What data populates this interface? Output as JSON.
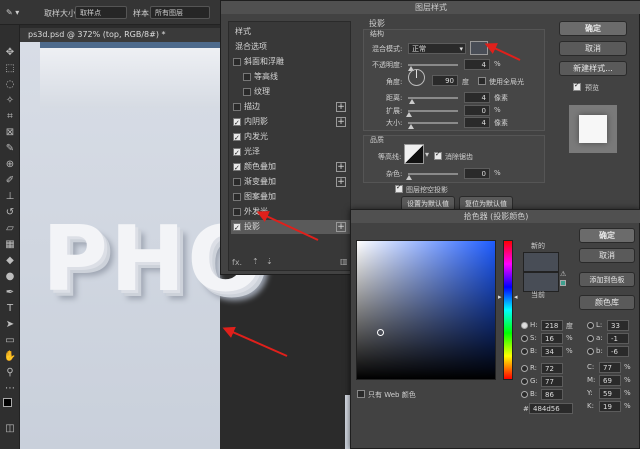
{
  "options_bar": {
    "sample_size_label": "取样大小:",
    "sample_size_value": "取样点",
    "sample_label": "样本:",
    "sample_value": "所有图层"
  },
  "document_tab": {
    "label": "ps3d.psd @ 372% (top, RGB/8#) *"
  },
  "canvas": {
    "text": "PHO"
  },
  "layer_style": {
    "title": "图层样式",
    "list": [
      {
        "label": "样式",
        "checkbox": null,
        "plus": false,
        "indent": false
      },
      {
        "label": "混合选项",
        "checkbox": null,
        "plus": false,
        "indent": false
      },
      {
        "label": "斜面和浮雕",
        "checkbox": false,
        "plus": false,
        "indent": false
      },
      {
        "label": "等高线",
        "checkbox": false,
        "plus": false,
        "indent": true
      },
      {
        "label": "纹理",
        "checkbox": false,
        "plus": false,
        "indent": true
      },
      {
        "label": "描边",
        "checkbox": false,
        "plus": true,
        "indent": false
      },
      {
        "label": "内阴影",
        "checkbox": true,
        "plus": true,
        "indent": false
      },
      {
        "label": "内发光",
        "checkbox": true,
        "plus": false,
        "indent": false
      },
      {
        "label": "光泽",
        "checkbox": true,
        "plus": false,
        "indent": false
      },
      {
        "label": "颜色叠加",
        "checkbox": true,
        "plus": true,
        "indent": false
      },
      {
        "label": "渐变叠加",
        "checkbox": false,
        "plus": true,
        "indent": false
      },
      {
        "label": "图案叠加",
        "checkbox": false,
        "plus": false,
        "indent": false
      },
      {
        "label": "外发光",
        "checkbox": false,
        "plus": false,
        "indent": false
      },
      {
        "label": "投影",
        "checkbox": true,
        "plus": true,
        "indent": false,
        "selected": true
      }
    ],
    "footer_fx": "fx.",
    "section_title": "投影",
    "structure_title": "结构",
    "blend_mode_label": "混合模式:",
    "blend_mode_value": "正常",
    "opacity_label": "不透明度:",
    "opacity_value": "4",
    "percent": "%",
    "angle_label": "角度:",
    "angle_value": "90",
    "degree_unit": "度",
    "global_light_label": "使用全局光",
    "distance_label": "距离:",
    "distance_value": "4",
    "spread_label": "扩展:",
    "spread_value": "0",
    "size_label": "大小:",
    "size_value": "4",
    "pixel_unit": "像素",
    "quality_title": "品质",
    "contour_label": "等高线:",
    "antialias_label": "消除锯齿",
    "noise_label": "杂色:",
    "noise_value": "0",
    "knockout_label": "图层挖空投影",
    "set_default_button": "设置为默认值",
    "reset_default_button": "复位为默认值",
    "ok_button": "确定",
    "cancel_button": "取消",
    "new_style_button": "新建样式...",
    "preview_label": "预览",
    "shadow_color": "#484d56"
  },
  "color_picker": {
    "title": "拾色器 (投影颜色)",
    "new_label": "新的",
    "current_label": "当前",
    "ok_button": "确定",
    "cancel_button": "取消",
    "add_swatch_button": "添加到色板",
    "color_library_button": "颜色库",
    "web_only_label": "只有 Web 颜色",
    "fields_left": [
      {
        "label": "H:",
        "value": "218",
        "unit": "度",
        "selected": true
      },
      {
        "label": "S:",
        "value": "16",
        "unit": "%"
      },
      {
        "label": "B:",
        "value": "34",
        "unit": "%"
      },
      {
        "label": "R:",
        "value": "72",
        "unit": ""
      },
      {
        "label": "G:",
        "value": "77",
        "unit": ""
      },
      {
        "label": "B:",
        "value": "86",
        "unit": ""
      }
    ],
    "fields_lab": [
      {
        "label": "L:",
        "value": "33"
      },
      {
        "label": "a:",
        "value": "-1"
      },
      {
        "label": "b:",
        "value": "-6"
      }
    ],
    "fields_cmyk": [
      {
        "label": "C:",
        "value": "77",
        "unit": "%"
      },
      {
        "label": "M:",
        "value": "69",
        "unit": "%"
      },
      {
        "label": "Y:",
        "value": "59",
        "unit": "%"
      },
      {
        "label": "K:",
        "value": "19",
        "unit": "%"
      }
    ],
    "hex_label": "#",
    "hex_value": "484d56",
    "new_color": "#484d56",
    "current_color": "#484d56"
  },
  "accent": {
    "arrow": "#e0201b"
  }
}
